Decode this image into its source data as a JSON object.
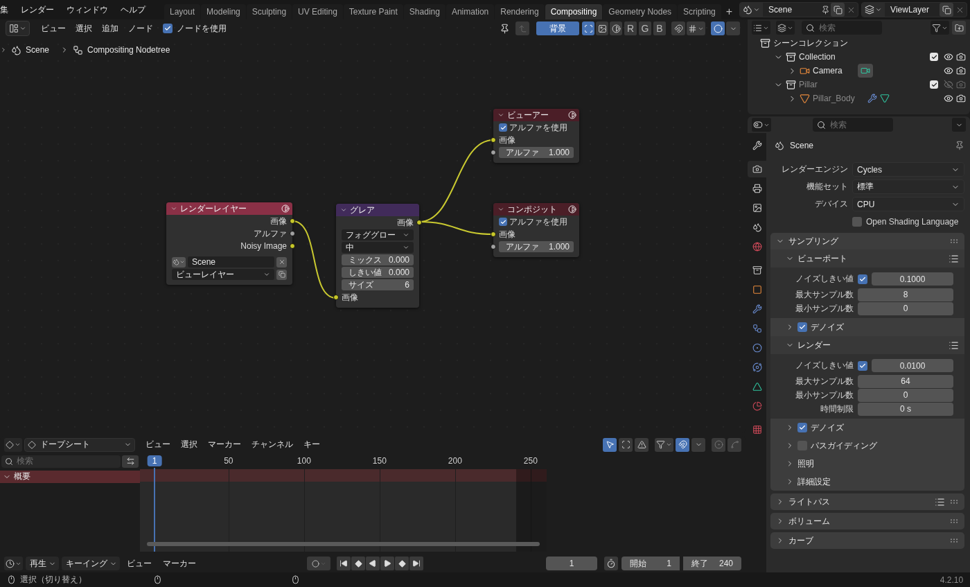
{
  "top_menu": [
    {
      "label": "集"
    },
    {
      "label": "レンダー"
    },
    {
      "label": "ウィンドウ"
    },
    {
      "label": "ヘルプ"
    }
  ],
  "workspace_tabs": [
    {
      "label": "Layout",
      "selected": false
    },
    {
      "label": "Modeling",
      "selected": false
    },
    {
      "label": "Sculpting",
      "selected": false
    },
    {
      "label": "UV Editing",
      "selected": false
    },
    {
      "label": "Texture Paint",
      "selected": false
    },
    {
      "label": "Shading",
      "selected": false
    },
    {
      "label": "Animation",
      "selected": false
    },
    {
      "label": "Rendering",
      "selected": false
    },
    {
      "label": "Compositing",
      "selected": true
    },
    {
      "label": "Geometry Nodes",
      "selected": false
    },
    {
      "label": "Scripting",
      "selected": false
    }
  ],
  "add_tab_label": "+",
  "scene_selector": {
    "value": "Scene"
  },
  "view_layer_selector": {
    "value": "ViewLayer"
  },
  "node_editor": {
    "menu": [
      "ビュー",
      "選択",
      "追加",
      "ノード"
    ],
    "use_nodes": {
      "label": "ノードを使用",
      "checked": true
    },
    "backdrop": {
      "label": "背景",
      "on": true
    },
    "display_toggles": [
      {
        "kind": "image_alpha",
        "selected": true
      },
      {
        "kind": "image",
        "selected": false
      },
      {
        "kind": "alpha",
        "selected": false
      }
    ],
    "channels": [
      {
        "label": "R",
        "selected": false
      },
      {
        "label": "G",
        "selected": false
      },
      {
        "label": "B",
        "selected": false
      }
    ],
    "breadcrumb": [
      {
        "label": "Scene",
        "kind": "scene"
      },
      {
        "label": "Compositing Nodetree",
        "kind": "nodetree"
      }
    ],
    "nodes": [
      {
        "kind": "render_layers",
        "title": "レンダーレイヤー",
        "color": "#8a3046",
        "rows": [
          {
            "kind": "output",
            "label": "画像",
            "color": "#c7c729"
          },
          {
            "kind": "output",
            "label": "アルファ",
            "color": "#a1a1a1"
          },
          {
            "kind": "output",
            "label": "Noisy Image",
            "color": "#c7c729"
          },
          {
            "kind": "scene_select",
            "value": "Scene"
          },
          {
            "kind": "layer_select",
            "value": "ビューレイヤー"
          }
        ]
      },
      {
        "kind": "filter",
        "title": "グレア",
        "color": "#412b5a",
        "rows": [
          {
            "kind": "output",
            "label": "画像",
            "color": "#c7c729"
          },
          {
            "kind": "select",
            "value": "フォググロー"
          },
          {
            "kind": "select",
            "value": "中"
          },
          {
            "kind": "slider",
            "label": "ミックス",
            "value": "0.000"
          },
          {
            "kind": "slider",
            "label": "しきい値",
            "value": "0.000"
          },
          {
            "kind": "slider",
            "label": "サイズ",
            "value": "6"
          },
          {
            "kind": "input",
            "label": "画像",
            "color": "#c7c729"
          }
        ]
      },
      {
        "kind": "output",
        "title": "ビューアー",
        "color": "#4b1e27",
        "rows": [
          {
            "kind": "checkbox",
            "label": "アルファを使用",
            "checked": true
          },
          {
            "kind": "input",
            "label": "画像",
            "color": "#c7c729"
          },
          {
            "kind": "input_slider",
            "label": "アルファ",
            "value": "1.000",
            "color": "#a1a1a1"
          }
        ]
      },
      {
        "kind": "output",
        "title": "コンポジット",
        "color": "#4b1e27",
        "rows": [
          {
            "kind": "checkbox",
            "label": "アルファを使用",
            "checked": true
          },
          {
            "kind": "input",
            "label": "画像",
            "color": "#c7c729"
          },
          {
            "kind": "input_slider",
            "label": "アルファ",
            "value": "1.000",
            "color": "#a1a1a1"
          }
        ]
      }
    ]
  },
  "outliner": {
    "search": {
      "placeholder": "検索"
    },
    "tree": [
      {
        "kind": "scene_collection",
        "label": "シーンコレクション",
        "children": [
          {
            "kind": "collection",
            "label": "Collection",
            "expanded": true,
            "checked": true,
            "visible": true,
            "disabled": false,
            "children": [
              {
                "kind": "camera",
                "label": "Camera",
                "expanded": false,
                "visible": true,
                "disabled": false,
                "extras": [
                  {
                    "kind": "camera_data"
                  }
                ]
              }
            ]
          },
          {
            "kind": "collection",
            "label": "Pillar",
            "expanded": true,
            "checked": true,
            "visible": false,
            "disabled": true,
            "children": [
              {
                "kind": "mesh",
                "label": "Pillar_Body",
                "expanded": false,
                "visible": true,
                "disabled": true,
                "extras": [
                  {
                    "kind": "modifier"
                  },
                  {
                    "kind": "mesh_data"
                  }
                ]
              }
            ]
          }
        ]
      }
    ]
  },
  "properties": {
    "search": {
      "placeholder": "検索"
    },
    "tabs": [
      {
        "kind": "tool",
        "selected": false
      },
      {
        "kind": "render",
        "selected": true
      },
      {
        "kind": "output",
        "selected": false
      },
      {
        "kind": "view_layer",
        "selected": false
      },
      {
        "kind": "scene",
        "selected": false
      },
      {
        "kind": "world",
        "selected": false
      },
      {
        "kind": "collection",
        "selected": false
      },
      {
        "kind": "object",
        "selected": false
      },
      {
        "kind": "modifier",
        "selected": false
      },
      {
        "kind": "particles",
        "selected": false
      },
      {
        "kind": "physics",
        "selected": false
      },
      {
        "kind": "constraints",
        "selected": false
      },
      {
        "kind": "data",
        "selected": false
      },
      {
        "kind": "material",
        "selected": false
      },
      {
        "kind": "texture",
        "selected": false
      }
    ],
    "context": "Scene",
    "fields": [
      {
        "label": "レンダーエンジン",
        "value": "Cycles"
      },
      {
        "label": "機能セット",
        "value": "標準"
      },
      {
        "label": "デバイス",
        "value": "CPU"
      }
    ],
    "osl": {
      "label": "Open Shading Language",
      "checked": false
    },
    "panels": [
      {
        "title": "サンプリング",
        "expanded": true,
        "presets": false,
        "children": [
          {
            "kind": "subpanel",
            "title": "ビューポート",
            "expanded": true,
            "presets": true,
            "rows": [
              {
                "kind": "toggle_value",
                "label": "ノイズしきい値",
                "checked": true,
                "value": "0.1000"
              },
              {
                "kind": "value",
                "label": "最大サンプル数",
                "value": "8"
              },
              {
                "kind": "value",
                "label": "最小サンプル数",
                "value": "0"
              }
            ]
          },
          {
            "kind": "check_subpanel",
            "title": "デノイズ",
            "expanded": false,
            "checked": true
          },
          {
            "kind": "subpanel",
            "title": "レンダー",
            "expanded": true,
            "presets": true,
            "rows": [
              {
                "kind": "toggle_value",
                "label": "ノイズしきい値",
                "checked": true,
                "value": "0.0100"
              },
              {
                "kind": "value",
                "label": "最大サンプル数",
                "value": "64"
              },
              {
                "kind": "value",
                "label": "最小サンプル数",
                "value": "0"
              },
              {
                "kind": "value",
                "label": "時間制限",
                "value": "0 s"
              }
            ]
          },
          {
            "kind": "check_subpanel",
            "title": "デノイズ",
            "expanded": false,
            "checked": true
          },
          {
            "kind": "check_subpanel",
            "title": "パスガイディング",
            "expanded": false,
            "checked": false
          },
          {
            "kind": "subpanel",
            "title": "照明",
            "expanded": false,
            "presets": false
          },
          {
            "kind": "subpanel",
            "title": "詳細設定",
            "expanded": false,
            "presets": false
          }
        ]
      },
      {
        "title": "ライトパス",
        "expanded": false,
        "presets": true
      },
      {
        "title": "ボリューム",
        "expanded": false,
        "presets": false
      },
      {
        "title": "カーブ",
        "expanded": false,
        "presets": false
      }
    ]
  },
  "dopesheet": {
    "mode": "ドープシート",
    "menu": [
      "ビュー",
      "選択",
      "マーカー",
      "チャンネル",
      "キー"
    ],
    "search": {
      "placeholder": "検索"
    },
    "channels": [
      {
        "label": "概要",
        "expanded": true
      }
    ],
    "current_frame": "1",
    "ruler": [
      "50",
      "100",
      "150",
      "200",
      "250"
    ]
  },
  "timeline": {
    "menus": [
      {
        "kind": "dropdown",
        "label": "再生"
      },
      {
        "kind": "dropdown",
        "label": "キーイング"
      },
      {
        "kind": "menu",
        "label": "ビュー"
      },
      {
        "kind": "menu",
        "label": "マーカー"
      }
    ],
    "frame": "1",
    "start": {
      "label": "開始",
      "value": "1"
    },
    "end": {
      "label": "終了",
      "value": "240"
    }
  },
  "status_bar": {
    "hint": "選択（切り替え）",
    "version": "4.2.10"
  }
}
